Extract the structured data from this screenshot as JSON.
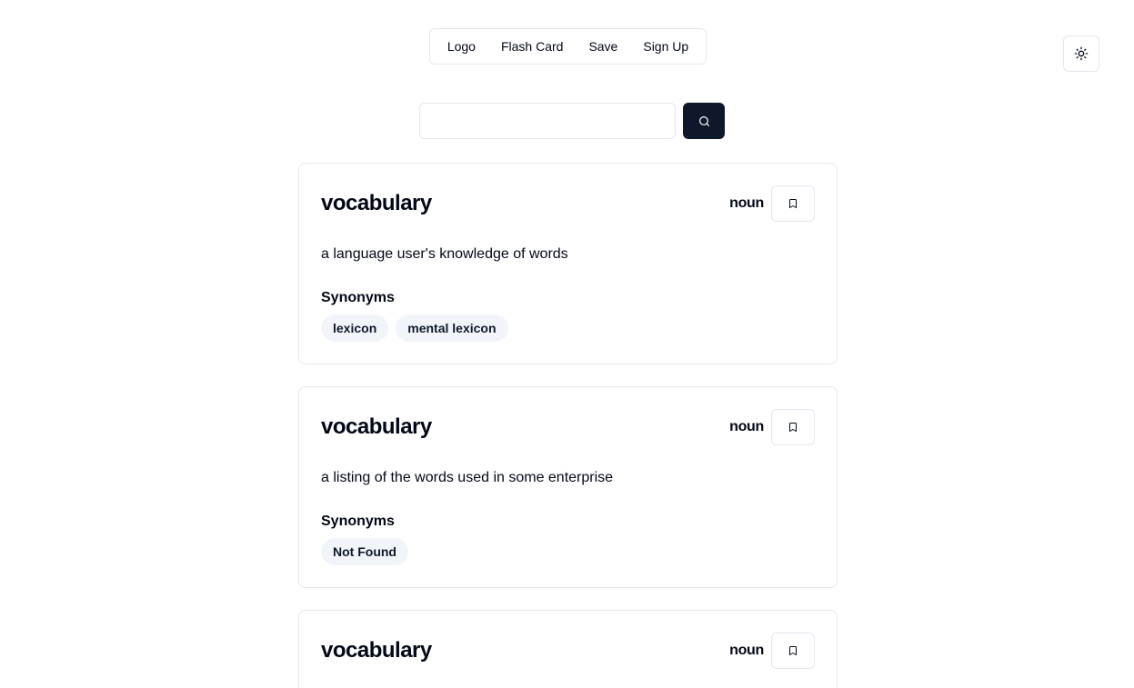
{
  "nav": {
    "items": [
      "Logo",
      "Flash Card",
      "Save",
      "Sign Up"
    ]
  },
  "theme_toggle": {
    "icon": "sun-icon"
  },
  "search": {
    "value": "",
    "placeholder": "",
    "button_icon": "search-icon"
  },
  "entries": [
    {
      "word": "vocabulary",
      "part_of_speech": "noun",
      "definition": "a language user's knowledge of words",
      "synonyms_title": "Synonyms",
      "synonyms": [
        "lexicon",
        "mental lexicon"
      ]
    },
    {
      "word": "vocabulary",
      "part_of_speech": "noun",
      "definition": "a listing of the words used in some enterprise",
      "synonyms_title": "Synonyms",
      "synonyms": [
        "Not Found"
      ]
    },
    {
      "word": "vocabulary",
      "part_of_speech": "noun"
    }
  ],
  "colors": {
    "primary": "#0f172a",
    "border": "#e2e8f0",
    "chip_bg": "#f1f5f9"
  }
}
